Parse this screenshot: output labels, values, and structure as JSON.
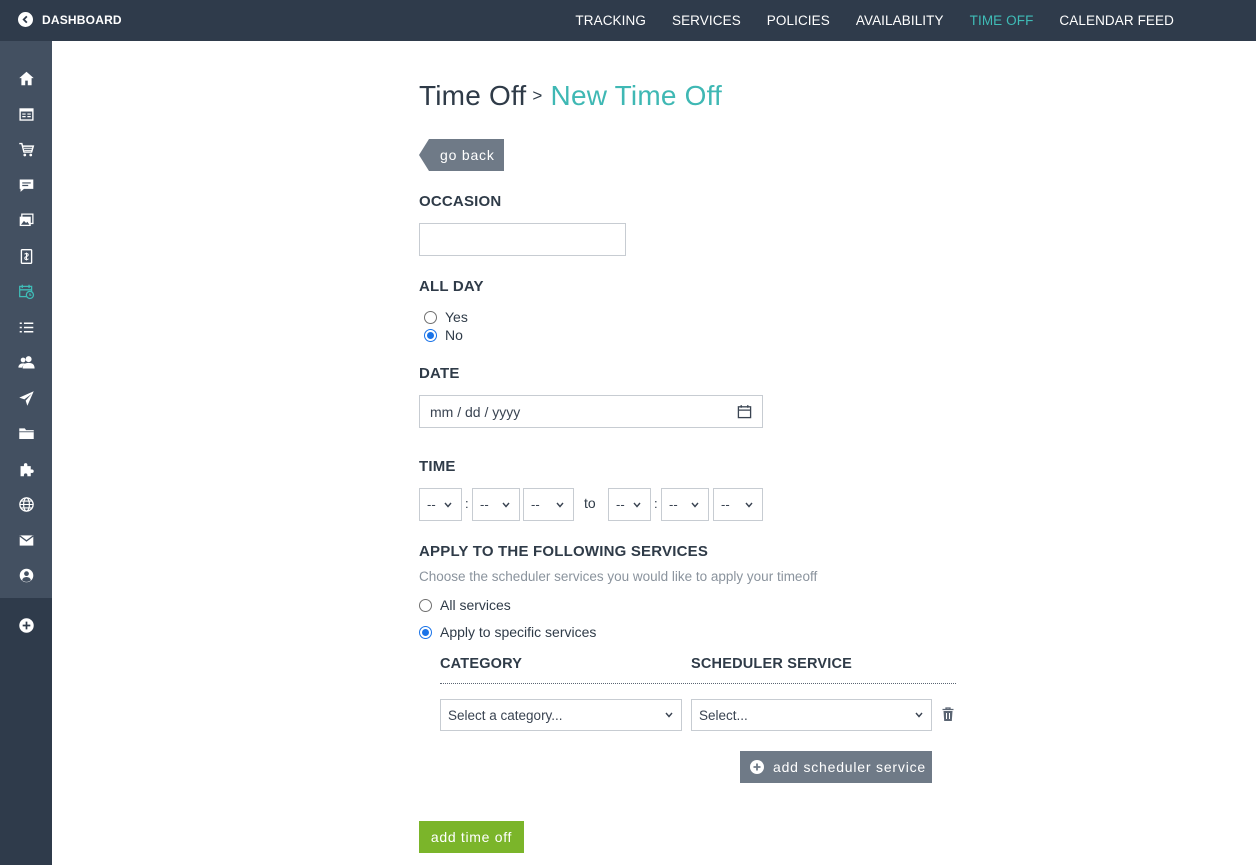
{
  "topbar": {
    "dashboard_label": "DASHBOARD",
    "nav": [
      {
        "label": "TRACKING",
        "active": false
      },
      {
        "label": "SERVICES",
        "active": false
      },
      {
        "label": "POLICIES",
        "active": false
      },
      {
        "label": "AVAILABILITY",
        "active": false
      },
      {
        "label": "TIME OFF",
        "active": true
      },
      {
        "label": "CALENDAR FEED",
        "active": false
      }
    ]
  },
  "sidebar": {
    "items": [
      {
        "icon": "home-icon"
      },
      {
        "icon": "table-icon"
      },
      {
        "icon": "cart-icon"
      },
      {
        "icon": "chat-icon"
      },
      {
        "icon": "gallery-icon"
      },
      {
        "icon": "document-icon"
      },
      {
        "icon": "calendar-clock-icon",
        "active": true
      },
      {
        "icon": "list-icon"
      },
      {
        "icon": "users-icon"
      },
      {
        "icon": "send-icon"
      },
      {
        "icon": "folder-icon"
      },
      {
        "icon": "puzzle-icon"
      },
      {
        "icon": "globe-icon"
      },
      {
        "icon": "mail-icon"
      },
      {
        "icon": "account-icon"
      }
    ],
    "add_icon": "add-circle-icon"
  },
  "colors": {
    "topbar_bg": "#2f3b4b",
    "accent_teal": "#3fbcb7",
    "button_gray": "#6f7a87",
    "submit_green": "#7bb52a",
    "radio_blue": "#1a73e8"
  },
  "page": {
    "title": "Time Off",
    "separator": ">",
    "crumb": "New Time Off",
    "go_back": "go back"
  },
  "form": {
    "occasion_label": "OCCASION",
    "occasion_value": "",
    "all_day_label": "ALL DAY",
    "all_day_options": [
      {
        "label": "Yes",
        "checked": false
      },
      {
        "label": "No",
        "checked": true
      }
    ],
    "date_label": "DATE",
    "date_placeholder": "mm / dd / yyyy",
    "time_label": "TIME",
    "time_start": [
      "--",
      "--",
      "--"
    ],
    "time_to": "to",
    "time_end": [
      "--",
      "--",
      "--"
    ],
    "time_colon": ":",
    "services_label": "APPLY TO THE FOLLOWING SERVICES",
    "services_hint": "Choose the scheduler services you would like to apply your timeoff",
    "services_options": [
      {
        "label": "All services",
        "checked": false
      },
      {
        "label": "Apply to specific services",
        "checked": true
      }
    ],
    "category_header": "CATEGORY",
    "scheduler_header": "SCHEDULER SERVICE",
    "category_select": "Select a category...",
    "scheduler_select": "Select...",
    "add_scheduler_label": "add scheduler service",
    "submit_label": "add time off"
  }
}
